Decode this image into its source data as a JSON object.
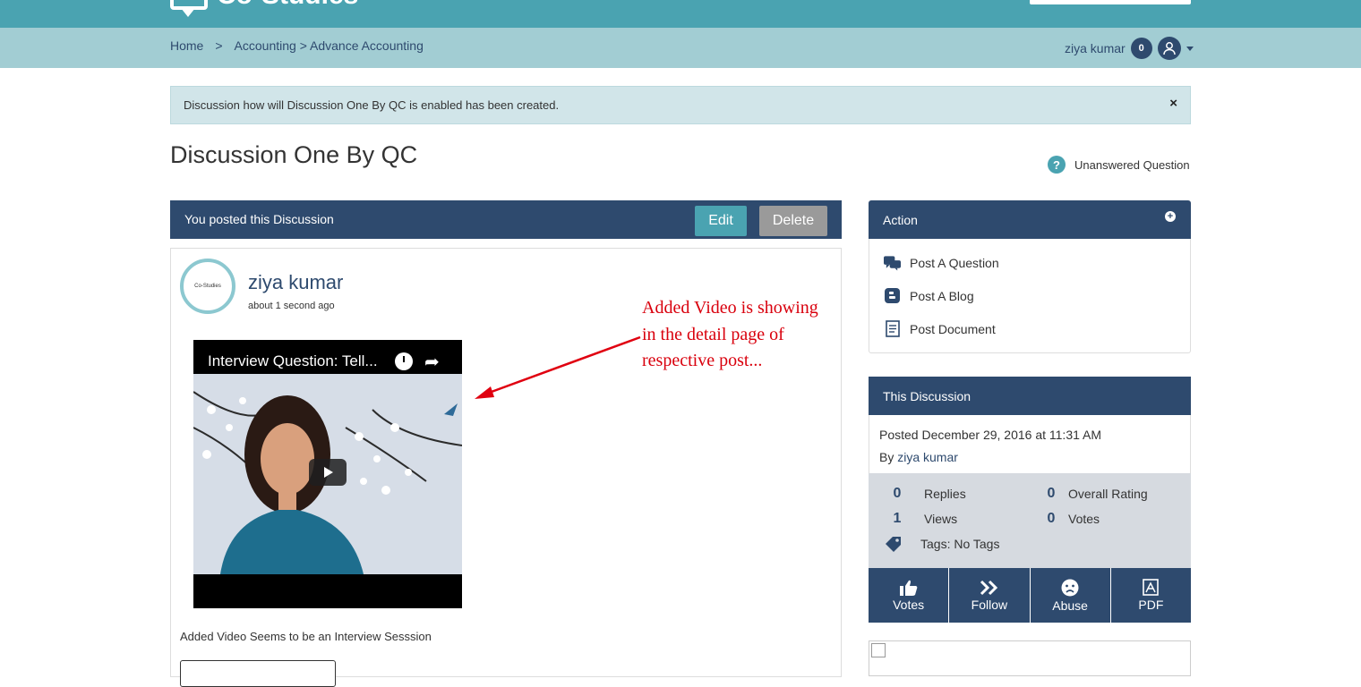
{
  "header": {
    "logo_text": "Co-Studies"
  },
  "breadcrumb": {
    "home": "Home",
    "separator": ">",
    "category": "Accounting > Advance Accounting"
  },
  "user": {
    "name": "ziya kumar",
    "notification_count": "0"
  },
  "alert": {
    "message": "Discussion how will Discussion One By QC is enabled has been created.",
    "close": "×"
  },
  "page": {
    "title": "Discussion One By QC",
    "status": "Unanswered Question"
  },
  "post_header": {
    "label": "You posted this Discussion",
    "edit": "Edit",
    "delete": "Delete"
  },
  "post": {
    "author": "ziya kumar",
    "time": "about 1 second ago",
    "avatar_text": "Co-Studies",
    "video_title": "Interview Question: Tell...",
    "body": "Added Video Seems to be an Interview Sesssion"
  },
  "annotation": {
    "line1": "Added Video is showing",
    "line2": "in the detail page of",
    "line3": "respective post..."
  },
  "action_panel": {
    "title": "Action",
    "items": [
      {
        "label": "Post A Question",
        "icon": "chat-bubbles-icon"
      },
      {
        "label": "Post A Blog",
        "icon": "blog-icon"
      },
      {
        "label": "Post Document",
        "icon": "document-icon"
      }
    ]
  },
  "discussion_panel": {
    "title": "This Discussion",
    "posted": "Posted December 29, 2016 at 11:31 AM",
    "by_prefix": "By",
    "by_name": "ziya kumar",
    "stats": {
      "replies_num": "0",
      "replies_label": "Replies",
      "rating_num": "0",
      "rating_label": "Overall Rating",
      "views_num": "1",
      "views_label": "Views",
      "votes_num": "0",
      "votes_label": "Votes",
      "tags": "Tags: No Tags"
    },
    "buttons": {
      "votes": "Votes",
      "follow": "Follow",
      "abuse": "Abuse",
      "pdf": "PDF"
    }
  },
  "colors": {
    "teal": "#4aa3b1",
    "navy": "#2e4a6e",
    "annotation_red": "#d9000d"
  }
}
